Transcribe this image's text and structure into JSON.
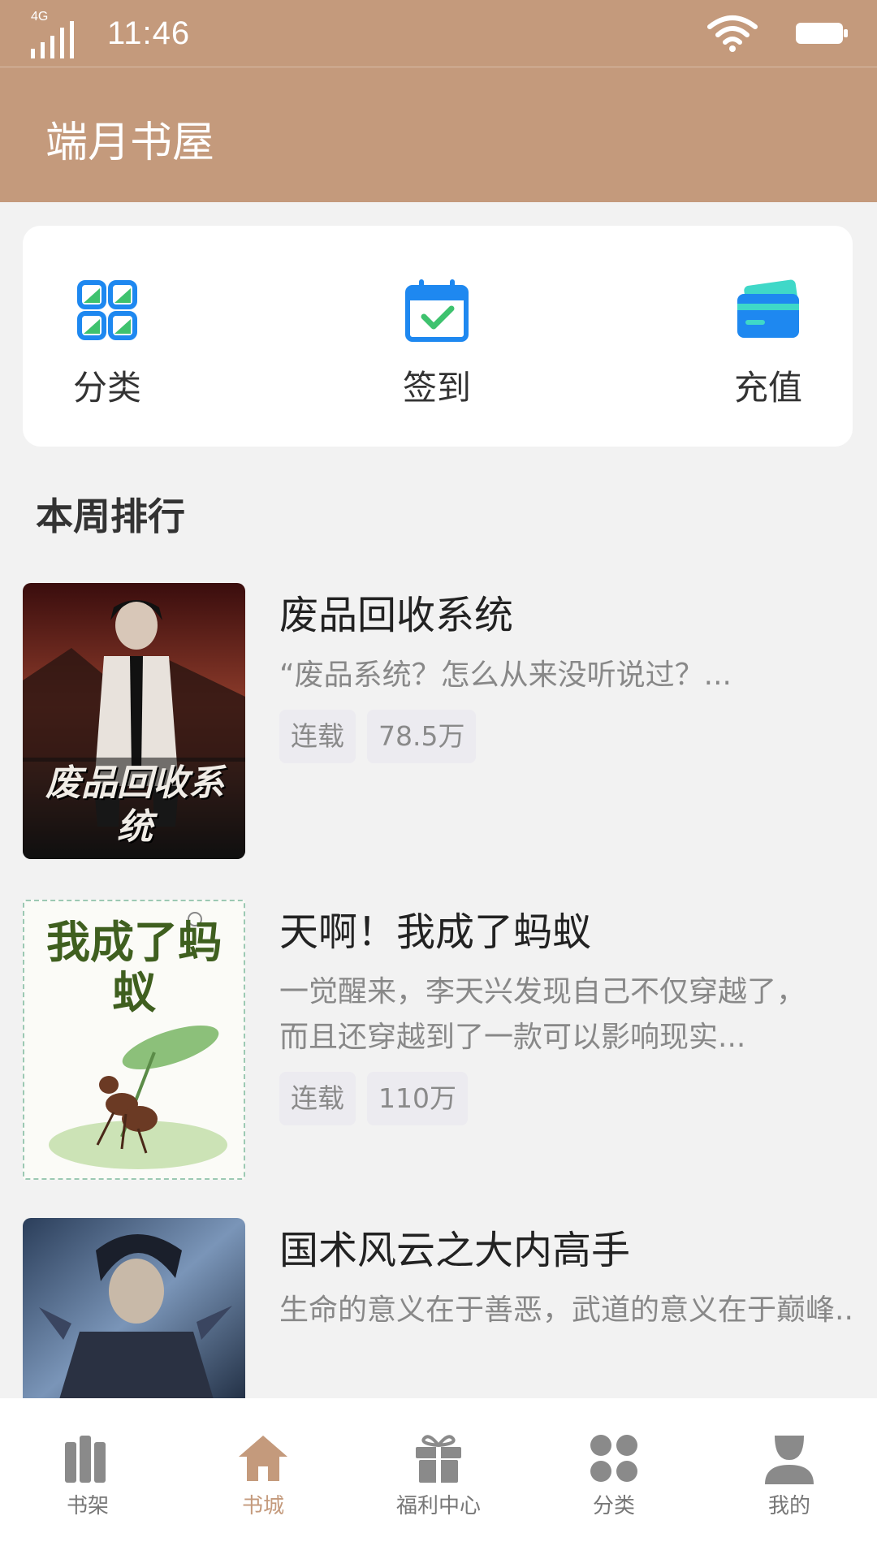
{
  "status_bar": {
    "network": "4G",
    "time": "11:46"
  },
  "header": {
    "title": "端月书屋"
  },
  "quick_actions": [
    {
      "label": "分类",
      "icon": "grid-icon"
    },
    {
      "label": "签到",
      "icon": "calendar-check-icon"
    },
    {
      "label": "充值",
      "icon": "credit-card-icon"
    }
  ],
  "section": {
    "title": "本周排行"
  },
  "books": [
    {
      "title": "废品回收系统",
      "desc": "“废品系统？怎么从来没听说过？...",
      "status": "连载",
      "count": "78.5万",
      "cover_text": "废品回收系统"
    },
    {
      "title": "天啊！我成了蚂蚁",
      "desc": "一觉醒来，李天兴发现自己不仅穿越了，而且还穿越到了一款可以影响现实...",
      "status": "连载",
      "count": "110万",
      "cover_text": "我成了蚂蚁"
    },
    {
      "title": "国术风云之大内高手",
      "desc": "生命的意义在于善恶，武道的意义在于巅峰..."
    }
  ],
  "tabs": [
    {
      "label": "书架",
      "icon": "bookshelf-icon",
      "active": false
    },
    {
      "label": "书城",
      "icon": "home-icon",
      "active": true
    },
    {
      "label": "福利中心",
      "icon": "gift-icon",
      "active": false
    },
    {
      "label": "分类",
      "icon": "four-dots-icon",
      "active": false
    },
    {
      "label": "我的",
      "icon": "user-icon",
      "active": false
    }
  ],
  "colors": {
    "brand": "#c49a7c",
    "background": "#f2f2f2",
    "icon_blue": "#1e88f0",
    "icon_green": "#3ec26e",
    "tab_icon": "#8a8a8a"
  }
}
